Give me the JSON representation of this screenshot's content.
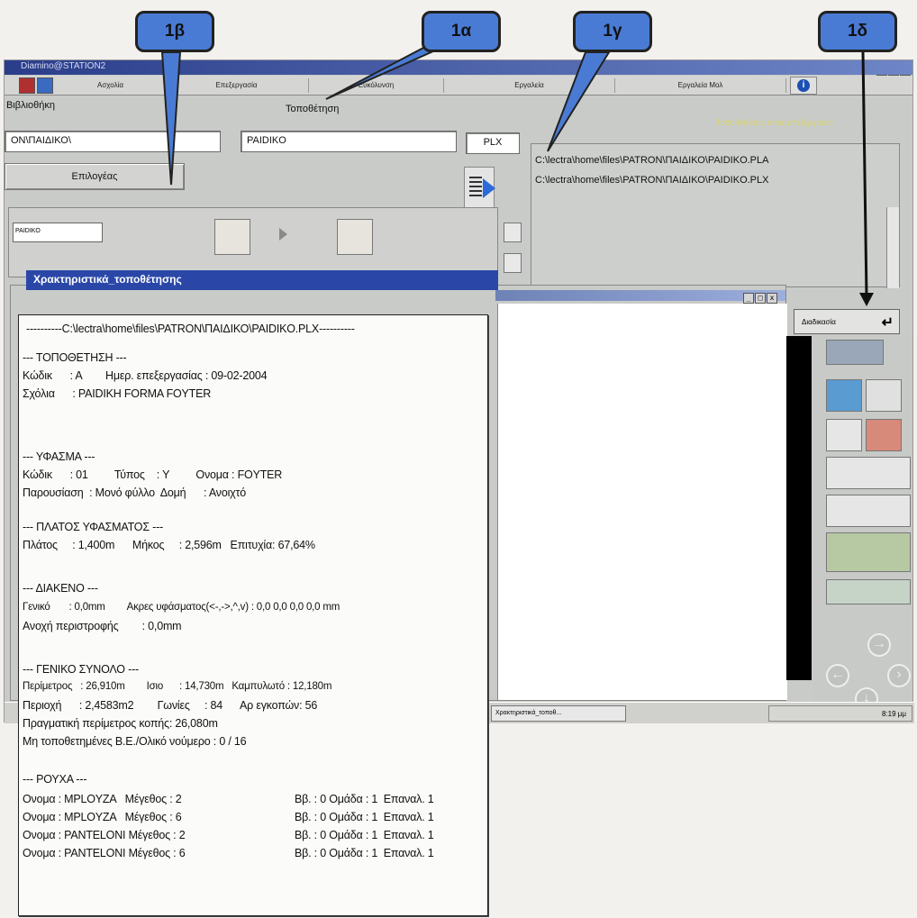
{
  "titlebar": {
    "title": "Diamino@STATION2"
  },
  "menu": [
    "Ασχολία",
    "Επεξεργασία",
    "Ευκόλυνση",
    "Εργαλεία",
    "Εργαλεία Mολ"
  ],
  "window_controls": [
    "_",
    "□",
    "x"
  ],
  "header": {
    "library_label": "Βιβλιοθήκη",
    "placement_label": "Τοποθέτηση",
    "status_text": "Τοποθετήσεις προς επεξεργασία"
  },
  "fields": {
    "library_path": "ΟΝ\\ΠΑΙΔΙΚΟ\\",
    "placement_name": "PAIDIKO",
    "extension": "PLX",
    "mini_name": "PAIDIKO"
  },
  "buttons": {
    "select_label": "Επιλογέας",
    "process_label": "Διαδικασία"
  },
  "paths": [
    "C:\\lectra\\home\\files\\PATRON\\ΠΑΙΔΙΚΟ\\PAIDIKO.PLA",
    "C:\\lectra\\home\\files\\PATRON\\ΠΑΙΔΙΚΟ\\PAIDIKO.PLX"
  ],
  "inner_window": {
    "title": "Χρακτηριστικά_τοποθέτησης"
  },
  "taskbar": {
    "task": "Χρακτηριστικά_τοποθ...",
    "clock": "8:19 μμ"
  },
  "callouts": [
    "1β",
    "1α",
    "1γ",
    "1δ"
  ],
  "report": {
    "header": "----------C:\\lectra\\home\\files\\PATRON\\ΠΑΙΔΙΚΟ\\PAIDIKO.PLX----------",
    "placement_title": "--- ΤΟΠΟΘΕΤΗΣΗ ---",
    "code_line": "Κώδικ      : Α        Ημερ. επεξεργασίας : 09-02-2004",
    "comment_line": "Σχόλια      : PAIDIKH FORMA FOYTER",
    "fabric_title": "--- ΥΦΑΣΜΑ ---",
    "fabric_line1": "Κώδικ      : 01         Τύπος    : Υ         Ονομα : FOYTER",
    "fabric_line2": "Παρουσίαση  : Μονό φύλλο  Δομή      : Ανοιχτό",
    "width_title": "--- ΠΛΑΤΟΣ ΥΦΑΣΜΑΤΟΣ ---",
    "width_line": "Πλάτος     : 1,400m      Μήκος     : 2,596m   Επιτυχία: 67,64%",
    "gap_title": "--- ΔΙΑΚΕΝΟ ---",
    "gap_line1": "Γενικό       : 0,0mm        Ακρες υφάσματος(<-,->,^,v) : 0,0 0,0 0,0 0,0 mm",
    "gap_line2": "Ανοχή περιστροφής        : 0,0mm",
    "total_title": "--- ΓΕΝΙΚΟ ΣΥΝΟΛΟ ---",
    "total_line1": "Περίμετρος   : 26,910m        Ισιο      : 14,730m   Καμπυλωτό : 12,180m",
    "total_line2": "Περιοχή      : 2,4583m2        Γωνίες     : 84      Αρ εγκοπών: 56",
    "total_line3": "Πραγματική περίμετρος κοπής: 26,080m",
    "total_line4": "Μη τοποθετημένες Β.Ε./Ολικό νούμερο : 0 / 16",
    "clothes_title": "--- ΡΟΥΧΑ ---",
    "clothes": [
      {
        "name": "Ονομα : MPLOYZA   Μέγεθος : 2",
        "info": "Ββ. : 0 Ομάδα : 1  Επαναλ. 1"
      },
      {
        "name": "Ονομα : MPLOYZA   Μέγεθος : 6",
        "info": "Ββ. : 0 Ομάδα : 1  Επαναλ. 1"
      },
      {
        "name": "Ονομα : PANTELONI Μέγεθος : 2",
        "info": "Ββ. : 0 Ομάδα : 1  Επαναλ. 1"
      },
      {
        "name": "Ονομα : PANTELONI Μέγεθος : 6",
        "info": "Ββ. : 0 Ομάδα : 1  Επαναλ. 1"
      }
    ]
  },
  "icons": [
    "logo-icon",
    "toolbar-icon",
    "info-icon",
    "document-icon",
    "monitor-icon",
    "arrow-right-icon",
    "enter-arrow-icon",
    "navigation-icon"
  ],
  "colors": {
    "callout": "#4a7bd4",
    "titlebar": "#2a47a8",
    "status_text": "#d9d46a"
  }
}
